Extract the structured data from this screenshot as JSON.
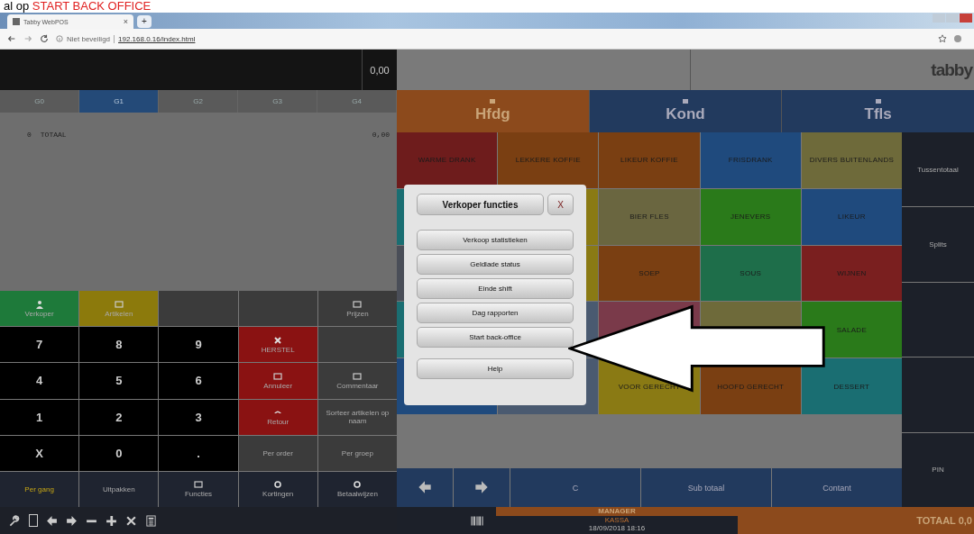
{
  "caption": {
    "text": "al op",
    "highlight": "START BACK OFFICE"
  },
  "browser": {
    "tab_title": "Tabby WebPOS",
    "close": "×",
    "new_tab": "+",
    "security": "Niet beveiligd",
    "url": "192.168.0.16/index.html"
  },
  "display": {
    "amount": "0,00"
  },
  "groups": [
    {
      "label": "G0",
      "selected": false
    },
    {
      "label": "G1",
      "selected": true
    },
    {
      "label": "G2",
      "selected": false
    },
    {
      "label": "G3",
      "selected": false
    },
    {
      "label": "G4",
      "selected": false
    }
  ],
  "order": {
    "rows": [
      {
        "qty": "0",
        "name": "TOTAAL",
        "amount": "0,00"
      }
    ]
  },
  "keypad": [
    {
      "label": "Verkoper",
      "color": "#1e7a3a"
    },
    {
      "label": "Artikelen",
      "color": "#8c7a0c"
    },
    {
      "color": "#3b3b3b"
    },
    {
      "color": "#3b3b3b"
    },
    {
      "label": "Prijzen",
      "color": "#3b3b3b"
    },
    {
      "label": "7",
      "color": "#000000"
    },
    {
      "label": "8",
      "color": "#000000"
    },
    {
      "label": "9",
      "color": "#000000"
    },
    {
      "label": "HERSTEL",
      "color": "#8a1212"
    },
    {
      "color": "#3b3b3b"
    },
    {
      "label": "4",
      "color": "#000000"
    },
    {
      "label": "5",
      "color": "#000000"
    },
    {
      "label": "6",
      "color": "#000000"
    },
    {
      "label": "Annuleer",
      "color": "#8a1212"
    },
    {
      "label": "Commentaar",
      "color": "#3b3b3b"
    },
    {
      "label": "1",
      "color": "#000000"
    },
    {
      "label": "2",
      "color": "#000000"
    },
    {
      "label": "3",
      "color": "#000000"
    },
    {
      "label": "Retour",
      "color": "#8a1212"
    },
    {
      "label": "Sorteer artikelen op naam",
      "color": "#3b3b3b"
    },
    {
      "label": "X",
      "color": "#000000"
    },
    {
      "label": "0",
      "color": "#000000"
    },
    {
      "label": ".",
      "color": "#000000"
    },
    {
      "label": "Per order",
      "color": "#3b3b3b"
    },
    {
      "label": "Per groep",
      "color": "#3b3b3b"
    }
  ],
  "mode_bar": [
    {
      "label": "Per gang",
      "selected": true
    },
    {
      "label": "Uitpakken",
      "selected": false
    },
    {
      "label": "Functies",
      "selected": false
    },
    {
      "label": "Kortingen",
      "selected": false
    },
    {
      "label": "Betaalwijzen",
      "selected": false
    }
  ],
  "logo": "tabby",
  "categories": [
    {
      "label": "Hfdg",
      "selected": true
    },
    {
      "label": "Kond",
      "selected": false
    },
    {
      "label": "Tfls",
      "selected": false
    }
  ],
  "products": [
    {
      "label": "WARME DRANK",
      "color": "#6e1c1c"
    },
    {
      "label": "LEKKERE KOFFIE",
      "color": "#7a3f12"
    },
    {
      "label": "LIKEUR KOFFIE",
      "color": "#7a3f12"
    },
    {
      "label": "FRISDRANK",
      "color": "#1f4a7d"
    },
    {
      "label": "DIVERS BUITENLANDS",
      "color": "#6e6a3a"
    },
    {
      "color": "#1a6e72"
    },
    {
      "color": "#8a7a14"
    },
    {
      "label": "BIER FLES",
      "color": "#6a6640"
    },
    {
      "label": "JENEVERS",
      "color": "#2a7a1a"
    },
    {
      "label": "LIKEUR",
      "color": "#1f4a7d"
    },
    {
      "color": "#4a4e58"
    },
    {
      "color": "#8a7a14"
    },
    {
      "label": "SOEP",
      "color": "#7a3f12"
    },
    {
      "label": "SOUS",
      "color": "#1e6e4a"
    },
    {
      "label": "WIJNEN",
      "color": "#7a1f1f"
    },
    {
      "color": "#1a6e72"
    },
    {
      "color": "#4a5a70"
    },
    {
      "color": "#7a3a4a"
    },
    {
      "color": "#6e6a3a"
    },
    {
      "label": "SALADE",
      "color": "#2a7a1a"
    },
    {
      "color": "#1f4a7d"
    },
    {
      "color": "#4a5a70"
    },
    {
      "label": "VOOR GERECHT",
      "color": "#8a7a14"
    },
    {
      "label": "HOOFD GERECHT",
      "color": "#7a3f12"
    },
    {
      "label": "DESSERT",
      "color": "#1a6e72"
    }
  ],
  "side_buttons": [
    {
      "kind": "button",
      "label": "Tussentotaal"
    },
    {
      "kind": "button",
      "label": "Splits"
    },
    {
      "kind": "blank"
    },
    {
      "kind": "blank"
    },
    {
      "kind": "button",
      "label": "PIN"
    }
  ],
  "actions": [
    "C",
    "Sub totaal",
    "Contant"
  ],
  "status": {
    "user": "MANAGER",
    "register": "KASSA",
    "datetime": "18/09/2018 18:16",
    "total": "TOTAAL 0,0"
  },
  "dialog": {
    "title": "Verkoper functies",
    "close": "X",
    "buttons": [
      "Verkoop statistieken",
      "Geldlade status",
      "Einde shift",
      "Dag rapporten",
      "Start back-office",
      "Help"
    ]
  }
}
